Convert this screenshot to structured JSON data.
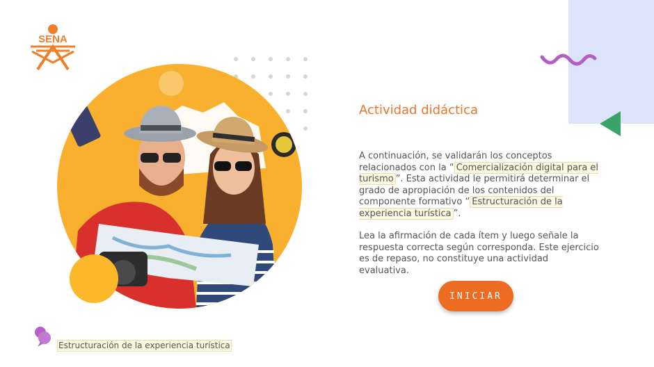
{
  "brand": {
    "logo_text": "SENA",
    "logo_color": "#f07f2a"
  },
  "activity": {
    "title": "Actividad didáctica",
    "intro_part1": "A continuación, se validarán los conceptos relacionados con la “",
    "intro_highlight1": "Comercialización digital para el turismo",
    "intro_part2": "”.  Esta actividad le permitirá determinar el grado de apropiación de los contenidos del componente formativo “",
    "intro_highlight2": "Estructuración de la experiencia turística",
    "intro_part3": "”.",
    "instructions": "Lea la afirmación de cada ítem y luego señale la respuesta correcta según corresponda.  Este ejercicio es de repaso, no constituye una actividad evaluativa."
  },
  "actions": {
    "start_label": "INICIAR"
  },
  "footer": {
    "course_label": "Estructuración de la experiencia turística"
  },
  "colors": {
    "accent": "#ee6b22",
    "title": "#e8752c",
    "circle": "#f9b02e",
    "wave": "#b35fc4",
    "triangle": "#3aa36a",
    "side_block": "#dbe4fb"
  },
  "icons": {
    "wave": "wave-decoration-icon",
    "triangle": "triangle-decoration-icon",
    "footer": "pin-icon"
  }
}
